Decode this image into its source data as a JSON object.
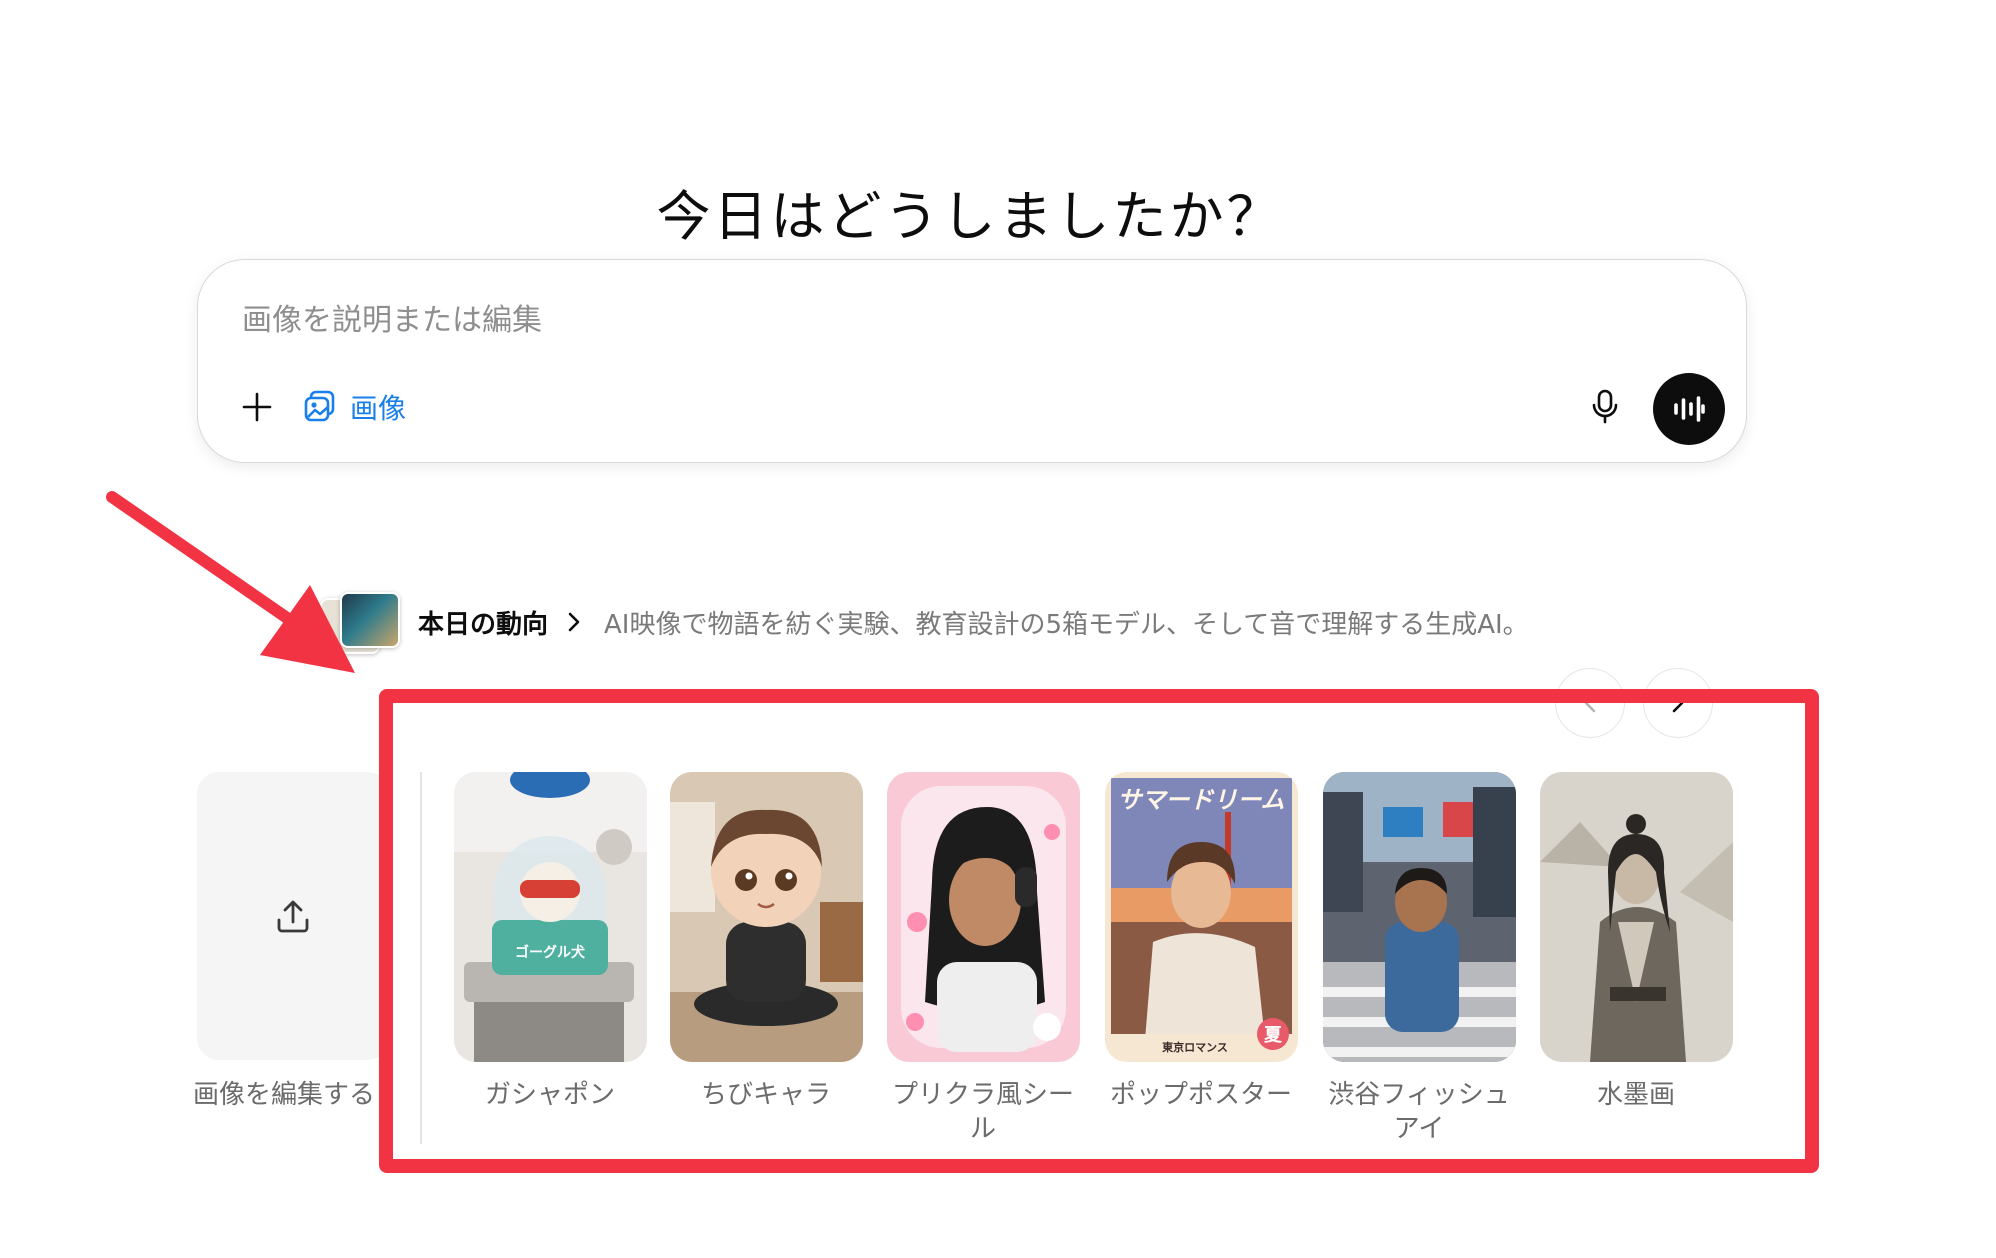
{
  "headline": "今日はどうしましたか？",
  "composer": {
    "placeholder": "画像を説明または編集",
    "image_chip_label": "画像"
  },
  "trend": {
    "title": "本日の動向",
    "description": "AI映像で物語を紡ぐ実験、教育設計の5箱モデル、そして音で理解する生成AI。"
  },
  "upload_tile": {
    "label": "画像を編集する"
  },
  "styles": [
    {
      "label": "ガシャポン"
    },
    {
      "label": "ちびキャラ"
    },
    {
      "label": "プリクラ風シー ル"
    },
    {
      "label": "ポップポスター"
    },
    {
      "label": "渋谷フィッシュ アイ"
    },
    {
      "label": "水墨画"
    }
  ],
  "poster_text": {
    "title": "サマードリーム",
    "footer": "東京ロマンス",
    "badge": "夏"
  },
  "gacha_label": "ゴーグル犬",
  "icons": {
    "plus": "plus-icon",
    "image": "image-stack-icon",
    "mic": "microphone-icon",
    "voice": "voice-waveform-icon",
    "chevron": "chevron-right-icon",
    "prev": "chevron-left-icon",
    "next": "chevron-right-icon",
    "upload": "upload-icon"
  },
  "colors": {
    "accent_blue": "#1a7fe8",
    "annotation_red": "#f23343",
    "voice_button": "#0d0d0d"
  }
}
